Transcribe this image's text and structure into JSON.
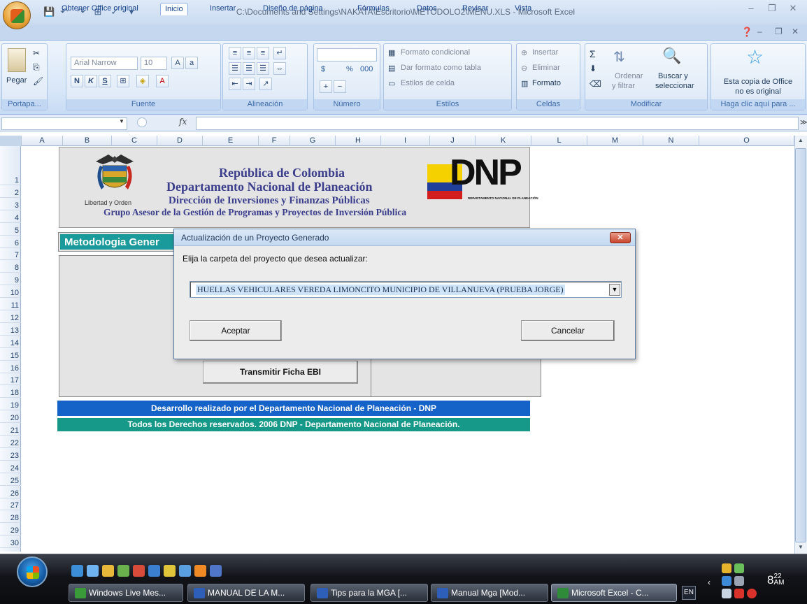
{
  "window": {
    "title": "C:\\Documents and Settings\\NAKATA\\Escritorio\\METODOLO2\\MENU.XLS - Microsoft Excel"
  },
  "ribbon": {
    "tabs": [
      "Obtener Office original",
      "Inicio",
      "Insertar",
      "Diseño de página",
      "Fórmulas",
      "Datos",
      "Revisar",
      "Vista"
    ],
    "active_tab": "Inicio",
    "clipboard": {
      "paste": "Pegar",
      "label": "Portapa..."
    },
    "font": {
      "name": "Arial Narrow",
      "size": "10",
      "bold": "N",
      "italic": "K",
      "underline": "S",
      "label": "Fuente"
    },
    "alignment": {
      "label": "Alineación"
    },
    "number": {
      "currency": "$",
      "percent": "%",
      "thousands": "000",
      "label": "Número"
    },
    "styles": {
      "conditional": "Formato condicional",
      "as_table": "Dar formato como tabla",
      "cell_styles": "Estilos de celda",
      "label": "Estilos"
    },
    "cells": {
      "insert": "Insertar",
      "delete": "Eliminar",
      "format": "Formato",
      "label": "Celdas"
    },
    "editing": {
      "sort1": "Ordenar",
      "sort2": "y filtrar",
      "find1": "Buscar y",
      "find2": "seleccionar",
      "label": "Modificar"
    },
    "genuine": {
      "line1": "Esta copia de Office",
      "line2": "no es original",
      "label": "Haga clic aquí para ..."
    }
  },
  "formula_bar": {
    "fx": "fx"
  },
  "grid": {
    "columns": [
      "A",
      "B",
      "C",
      "D",
      "E",
      "F",
      "G",
      "H",
      "I",
      "J",
      "K",
      "L",
      "M",
      "N",
      "O"
    ],
    "rows": [
      "1",
      "2",
      "3",
      "4",
      "5",
      "6",
      "7",
      "8",
      "9",
      "10",
      "11",
      "12",
      "13",
      "14",
      "15",
      "16",
      "17",
      "18",
      "19",
      "20",
      "21",
      "22",
      "23",
      "24",
      "25",
      "26",
      "27",
      "28",
      "29",
      "30"
    ]
  },
  "sheet": {
    "header": {
      "line1": "República de Colombia",
      "line2": "Departamento Nacional de Planeación",
      "line3": "Dirección de Inversiones y Finanzas Públicas",
      "line4": "Grupo Asesor de la Gestión de Programas y Proyectos de Inversión Pública",
      "motto": "Libertad y Orden",
      "dnp": "DNP",
      "dnp_sub": "DEPARTAMENTO NACIONAL DE PLANEACIÓN"
    },
    "menu_title": "Metodologia Gener",
    "transmit_button": "Transmitir Ficha EBI",
    "footer1": "Desarrollo realizado por el Departamento Nacional de Planeación - DNP",
    "footer2": "Todos los Derechos reservados. 2006 DNP - Departamento Nacional de Planeación."
  },
  "dialog": {
    "title": "Actualización de un Proyecto Generado",
    "prompt": "Elija la carpeta del proyecto que desea actualizar:",
    "selected_project": "HUELLAS VEHICULARES VEREDA LIMONCITO MUNICIPIO DE VILLANUEVA (PRUEBA JORGE)",
    "accept": "Aceptar",
    "cancel": "Cancelar"
  },
  "taskbar": {
    "items": [
      "Windows Live Mes...",
      "MANUAL DE LA M...",
      "Tips para la MGA [...",
      "Manual Mga [Mod...",
      "Microsoft Excel - C..."
    ],
    "active_item": "Microsoft Excel - C...",
    "lang": "EN",
    "clock_hour": "8",
    "clock_min": "22",
    "clock_ampm": "AM"
  }
}
